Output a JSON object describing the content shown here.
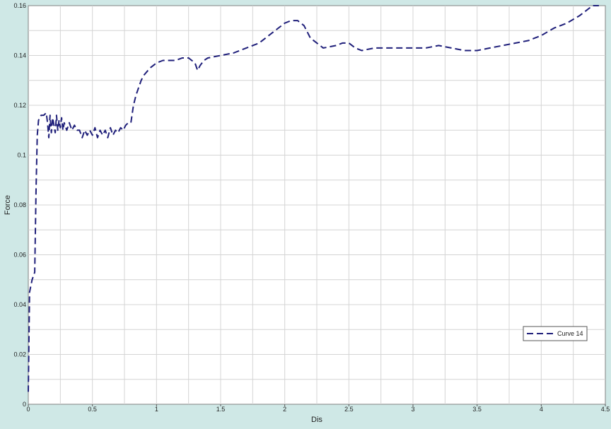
{
  "chart_data": {
    "type": "line",
    "title": "",
    "xlabel": "Dis",
    "ylabel": "Force",
    "xlim": [
      0,
      4.5
    ],
    "ylim": [
      0,
      0.16
    ],
    "x_ticks": [
      "0",
      "0.5",
      "1",
      "1.5",
      "2",
      "2.5",
      "3",
      "3.5",
      "4",
      "4.5"
    ],
    "y_ticks": [
      "0",
      "0.02",
      "0.04",
      "0.06",
      "0.08",
      "0.1",
      "0.12",
      "0.14",
      "0.16"
    ],
    "grid": true,
    "legend_position": "bottom-right",
    "series": [
      {
        "name": "Curve 14",
        "color": "#1f1f7a",
        "line_style": "dashed",
        "x": [
          0,
          0.01,
          0.03,
          0.05,
          0.06,
          0.07,
          0.08,
          0.1,
          0.12,
          0.14,
          0.15,
          0.16,
          0.17,
          0.18,
          0.19,
          0.2,
          0.21,
          0.22,
          0.23,
          0.24,
          0.25,
          0.26,
          0.27,
          0.28,
          0.3,
          0.32,
          0.34,
          0.36,
          0.38,
          0.4,
          0.42,
          0.44,
          0.46,
          0.48,
          0.5,
          0.52,
          0.54,
          0.56,
          0.58,
          0.6,
          0.62,
          0.64,
          0.66,
          0.68,
          0.7,
          0.72,
          0.74,
          0.76,
          0.78,
          0.8,
          0.82,
          0.84,
          0.86,
          0.88,
          0.9,
          0.95,
          1.0,
          1.05,
          1.1,
          1.15,
          1.2,
          1.25,
          1.3,
          1.32,
          1.34,
          1.37,
          1.4,
          1.5,
          1.6,
          1.7,
          1.8,
          1.9,
          2.0,
          2.05,
          2.1,
          2.15,
          2.2,
          2.3,
          2.4,
          2.45,
          2.5,
          2.55,
          2.6,
          2.7,
          2.8,
          2.9,
          3.0,
          3.1,
          3.2,
          3.3,
          3.4,
          3.5,
          3.6,
          3.7,
          3.8,
          3.9,
          4.0,
          4.1,
          4.2,
          4.3,
          4.4,
          4.45
        ],
        "y": [
          0.005,
          0.045,
          0.05,
          0.053,
          0.085,
          0.108,
          0.114,
          0.116,
          0.116,
          0.117,
          0.113,
          0.107,
          0.116,
          0.109,
          0.115,
          0.112,
          0.109,
          0.116,
          0.11,
          0.114,
          0.111,
          0.115,
          0.11,
          0.113,
          0.11,
          0.113,
          0.11,
          0.112,
          0.11,
          0.11,
          0.107,
          0.11,
          0.108,
          0.11,
          0.108,
          0.111,
          0.107,
          0.11,
          0.108,
          0.11,
          0.107,
          0.111,
          0.108,
          0.11,
          0.109,
          0.111,
          0.11,
          0.112,
          0.113,
          0.113,
          0.12,
          0.124,
          0.127,
          0.13,
          0.132,
          0.135,
          0.137,
          0.138,
          0.138,
          0.138,
          0.139,
          0.139,
          0.137,
          0.134,
          0.136,
          0.138,
          0.139,
          0.14,
          0.141,
          0.143,
          0.145,
          0.149,
          0.153,
          0.154,
          0.154,
          0.152,
          0.147,
          0.143,
          0.144,
          0.145,
          0.145,
          0.143,
          0.142,
          0.143,
          0.143,
          0.143,
          0.143,
          0.143,
          0.144,
          0.143,
          0.142,
          0.142,
          0.143,
          0.144,
          0.145,
          0.146,
          0.148,
          0.151,
          0.153,
          0.156,
          0.16,
          0.162
        ]
      }
    ]
  }
}
